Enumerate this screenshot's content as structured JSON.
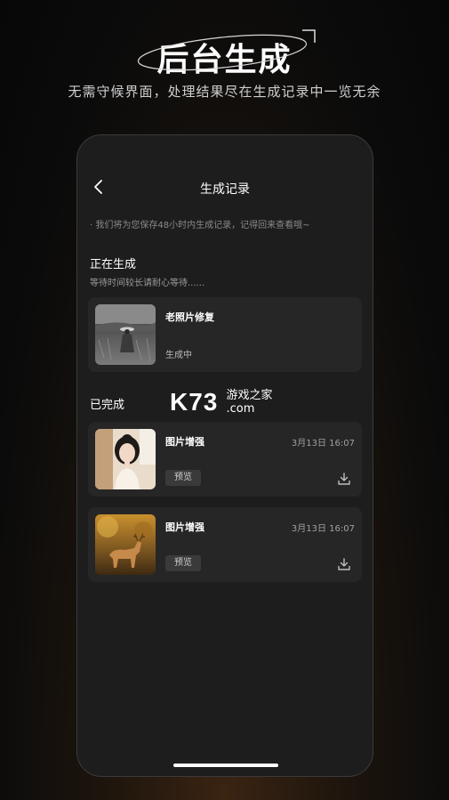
{
  "hero": {
    "title": "后台生成",
    "subtitle": "无需守候界面，处理结果尽在生成记录中一览无余"
  },
  "screen": {
    "nav_title": "生成记录",
    "notice": "· 我们将为您保存48小时内生成记录，记得回来查看哦~",
    "generating": {
      "title": "正在生成",
      "subtitle": "等待时间较长请耐心等待......",
      "item": {
        "title": "老照片修复",
        "status": "生成中",
        "thumb_icon": "old-photo-thumbnail"
      }
    },
    "completed": {
      "title": "已完成",
      "items": [
        {
          "title": "图片增强",
          "date": "3月13日 16:07",
          "preview_label": "预览",
          "thumb_icon": "portrait-thumbnail"
        },
        {
          "title": "图片增强",
          "date": "3月13日 16:07",
          "preview_label": "预览",
          "thumb_icon": "deer-thumbnail"
        }
      ]
    }
  },
  "watermark": {
    "logo": "K73",
    "cn": "游戏之家",
    "domain": ".com"
  },
  "colors": {
    "accent": "#4a9fd8",
    "card": "#262626",
    "phone_bg": "#1d1d1d"
  }
}
